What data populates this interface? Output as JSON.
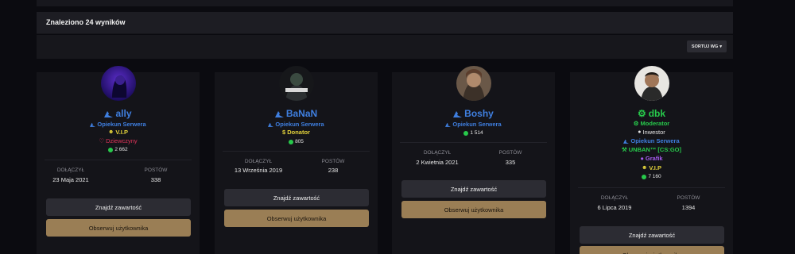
{
  "results": {
    "title": "Znaleziono 24 wyników"
  },
  "sort": {
    "label": "SORTUJ WG",
    "caret": "▾"
  },
  "colors": {
    "accent_blue": "#3f7fe0",
    "moderator_green": "#27c94b",
    "vip_yellow": "#e3d23b",
    "heart_red": "#e0355a",
    "gold_button": "#9a7e55",
    "grafik_purple": "#a65bef"
  },
  "stats_labels": {
    "joined": "DOŁĄCZYŁ",
    "posts": "POSTÓW"
  },
  "buttons": {
    "find": "Znajdź zawartość",
    "follow": "Obserwuj użytkownika"
  },
  "cards": [
    {
      "username": "ally",
      "roles": [
        "Opiekun Serwera",
        "V.I.P",
        "Dziewczyny"
      ],
      "reputation": "2 662",
      "joined": "23 Maja 2021",
      "posts": "338"
    },
    {
      "username": "BaNaN",
      "roles": [
        "Opiekun Serwera",
        "Donator"
      ],
      "reputation": "805",
      "joined": "13 Września 2019",
      "posts": "238"
    },
    {
      "username": "Boshy",
      "roles": [
        "Opiekun Serwera"
      ],
      "reputation": "1 514",
      "joined": "2 Kwietnia 2021",
      "posts": "335"
    },
    {
      "username": "dbk",
      "roles": [
        "Moderator",
        "Inwestor",
        "Opiekun Serwera",
        "UNBAN™ [CS:GO]",
        "Grafik",
        "V.I.P"
      ],
      "reputation": "7 160",
      "joined": "6 Lipca 2019",
      "posts": "1394"
    }
  ]
}
